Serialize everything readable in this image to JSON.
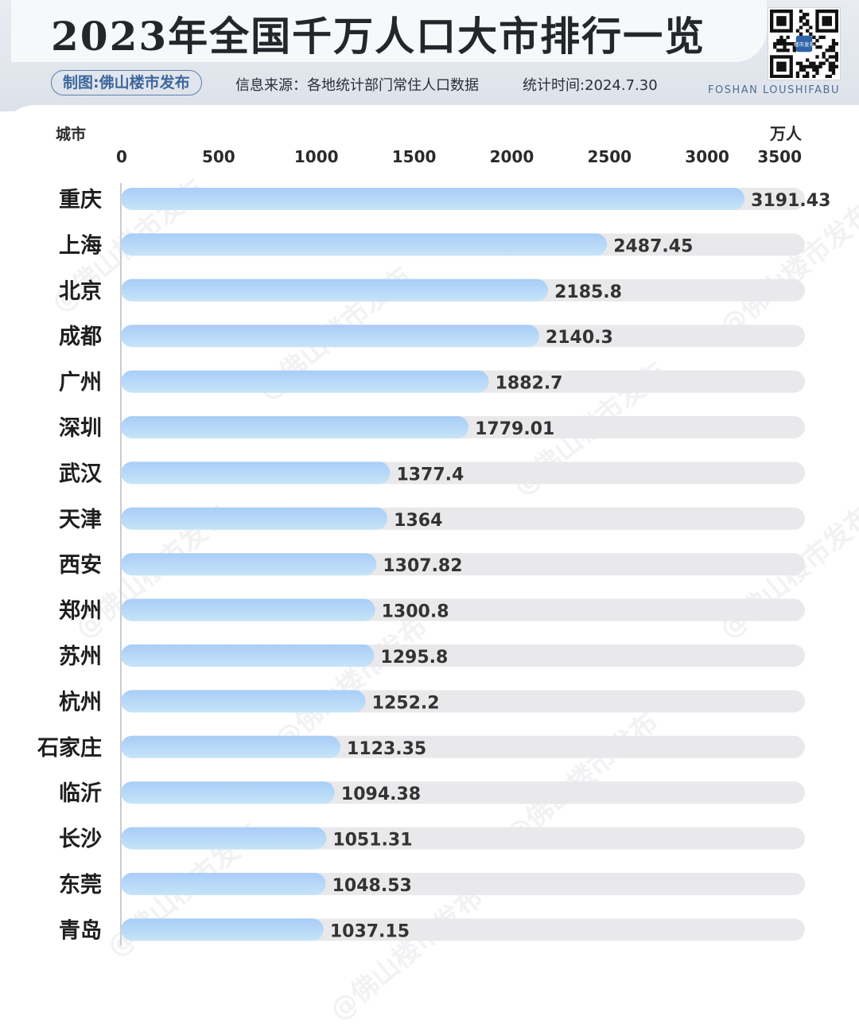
{
  "header": {
    "title": "2023年全国千万人口大市排行一览",
    "badge": "制图:佛山楼市发布",
    "source": "信息来源：各地统计部门常住人口数据",
    "time": "统计时间:2024.7.30",
    "brand_en": "FOSHAN LOUSHIFABU",
    "qr_label": "楼市发布"
  },
  "watermark": "@佛山楼市发布",
  "colors": {
    "bar_top": "#a8cdf7",
    "bar_bottom": "#c6e4f8",
    "track": "#e9e9eb",
    "badge": "#3e679c"
  },
  "chart_data": {
    "type": "bar",
    "orientation": "horizontal",
    "y_axis_title": "城市",
    "unit": "万人",
    "xlim": [
      0,
      3500
    ],
    "xticks": [
      0,
      500,
      1000,
      1500,
      2000,
      2500,
      3000,
      3500
    ],
    "categories": [
      "重庆",
      "上海",
      "北京",
      "成都",
      "广州",
      "深圳",
      "武汉",
      "天津",
      "西安",
      "郑州",
      "苏州",
      "杭州",
      "石家庄",
      "临沂",
      "长沙",
      "东莞",
      "青岛"
    ],
    "values": [
      3191.43,
      2487.45,
      2185.8,
      2140.3,
      1882.7,
      1779.01,
      1377.4,
      1364,
      1307.82,
      1300.8,
      1295.8,
      1252.2,
      1123.35,
      1094.38,
      1051.31,
      1048.53,
      1037.15
    ],
    "value_labels": [
      "3191.43",
      "2487.45",
      "2185.8",
      "2140.3",
      "1882.7",
      "1779.01",
      "1377.4",
      "1364",
      "1307.82",
      "1300.8",
      "1295.8",
      "1252.2",
      "1123.35",
      "1094.38",
      "1051.31",
      "1048.53",
      "1037.15"
    ]
  }
}
